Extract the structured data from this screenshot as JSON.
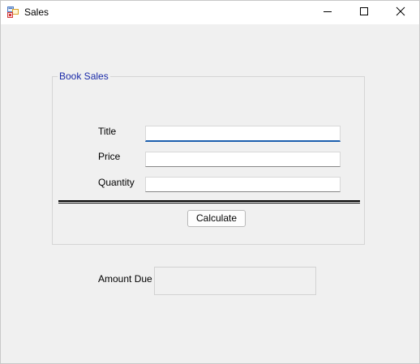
{
  "window": {
    "title": "Sales",
    "icon": "winforms-app-icon",
    "minimize_icon": "minimize-icon",
    "maximize_icon": "maximize-icon",
    "close_icon": "close-icon"
  },
  "group": {
    "title": "Book Sales"
  },
  "form": {
    "title_label": "Title",
    "title_value": "",
    "price_label": "Price",
    "price_value": "",
    "quantity_label": "Quantity",
    "quantity_value": "",
    "calculate_label": "Calculate"
  },
  "result": {
    "amount_label": "Amount Due",
    "amount_value": ""
  },
  "colors": {
    "group_title": "#1a2aa8",
    "focus_underline": "#1c5fae",
    "background": "#f0f0f0"
  }
}
